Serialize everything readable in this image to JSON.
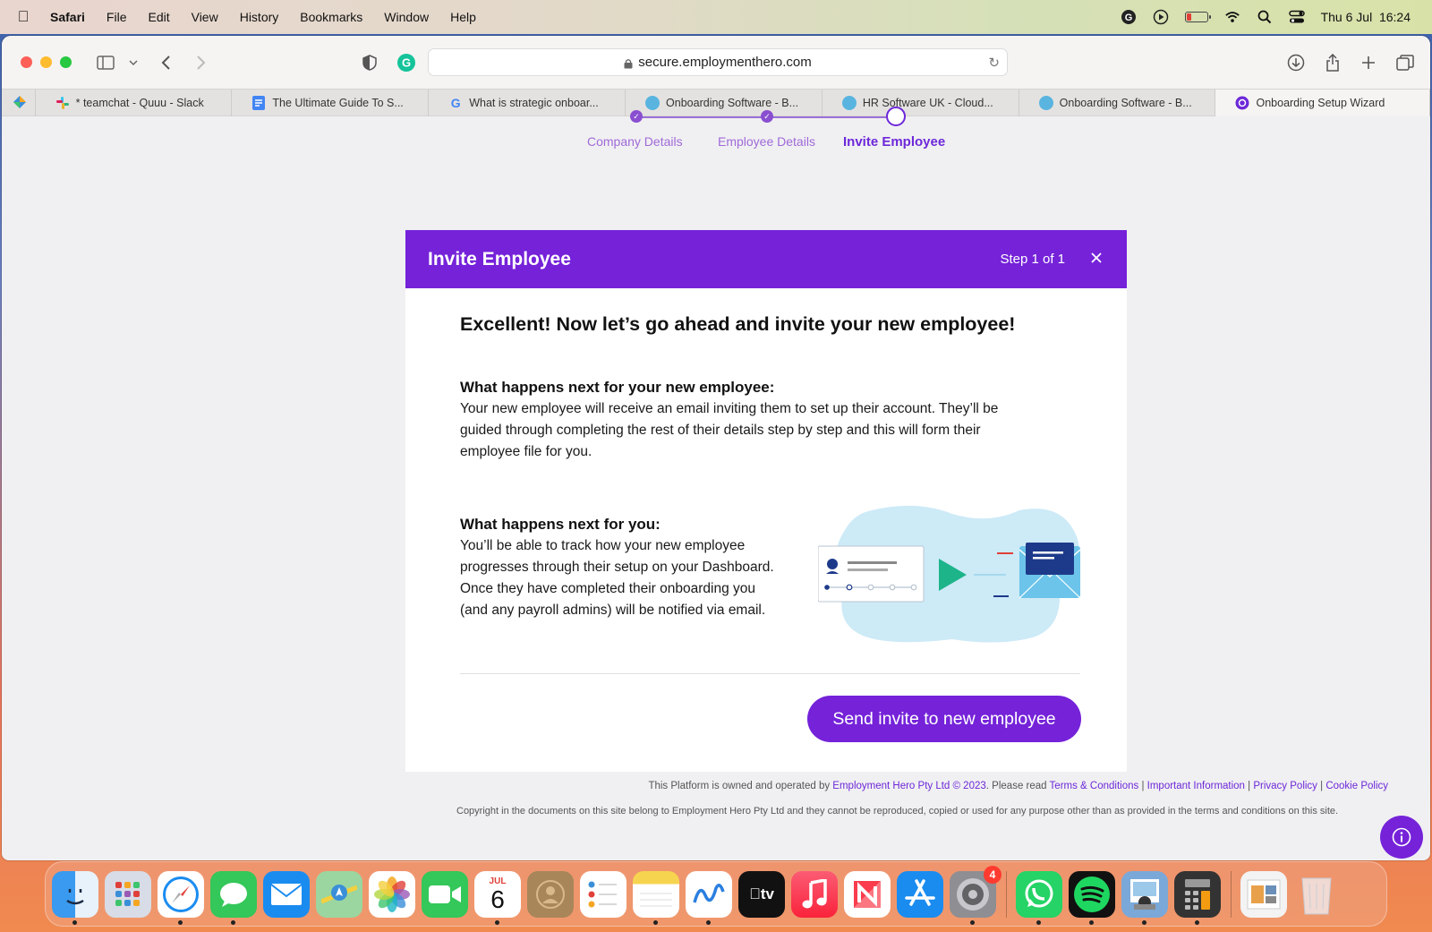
{
  "menubar": {
    "app_name": "Safari",
    "items": [
      "File",
      "Edit",
      "View",
      "History",
      "Bookmarks",
      "Window",
      "Help"
    ],
    "datetime": "Thu 6 Jul  16:24"
  },
  "browser": {
    "url": "secure.employmenthero.com",
    "tabs": [
      {
        "label": "* teamchat - Quuu - Slack"
      },
      {
        "label": "The Ultimate Guide To S..."
      },
      {
        "label": "What is strategic onboar..."
      },
      {
        "label": "Onboarding Software - B..."
      },
      {
        "label": "HR Software UK - Cloud..."
      },
      {
        "label": "Onboarding Software - B..."
      },
      {
        "label": "Onboarding Setup Wizard"
      }
    ]
  },
  "stepper": {
    "steps": [
      {
        "label": "Company Details"
      },
      {
        "label": "Employee Details"
      },
      {
        "label": "Invite Employee"
      }
    ]
  },
  "card": {
    "title": "Invite Employee",
    "step_text": "Step 1 of 1",
    "headline": "Excellent! Now let’s go ahead and invite your new employee!",
    "section1_title": "What happens next for your new employee:",
    "section1_line1": "Your new employee will receive an email inviting them to set up their account. They’ll be",
    "section1_line2": "guided through completing the rest of their details step by step and this will form their",
    "section1_line3": "employee file for you.",
    "section2_title": "What happens next for you:",
    "section2_line1": "You’ll be able to track how your new employee",
    "section2_line2": "progresses through their setup on your Dashboard.",
    "section2_line3": "Once they have completed their onboarding you",
    "section2_line4": "(and any payroll admins) will be notified via email.",
    "send_button": "Send invite to new employee"
  },
  "footer": {
    "prefix": "This Platform is owned and operated by ",
    "company": "Employment Hero Pty Ltd © 2023",
    "please_read": ". Please read ",
    "terms": "Terms & Conditions",
    "important": "Important Information",
    "privacy": "Privacy Policy",
    "cookie": "Cookie Policy",
    "sep": " | ",
    "copyright": "Copyright in the documents on this site belong to Employment Hero Pty Ltd and they cannot be reproduced, copied or used for any purpose other than as provided in the terms and conditions on this site."
  },
  "dock": {
    "calendar_month": "JUL",
    "calendar_day": "6",
    "settings_badge": "4",
    "tv_label": "tv"
  },
  "colors": {
    "brand_purple": "#7522d9",
    "step_purple": "#a06ad8",
    "illus_blue": "#cdeaf7",
    "illus_green": "#1db48a",
    "illus_navy": "#1d3a8a"
  }
}
